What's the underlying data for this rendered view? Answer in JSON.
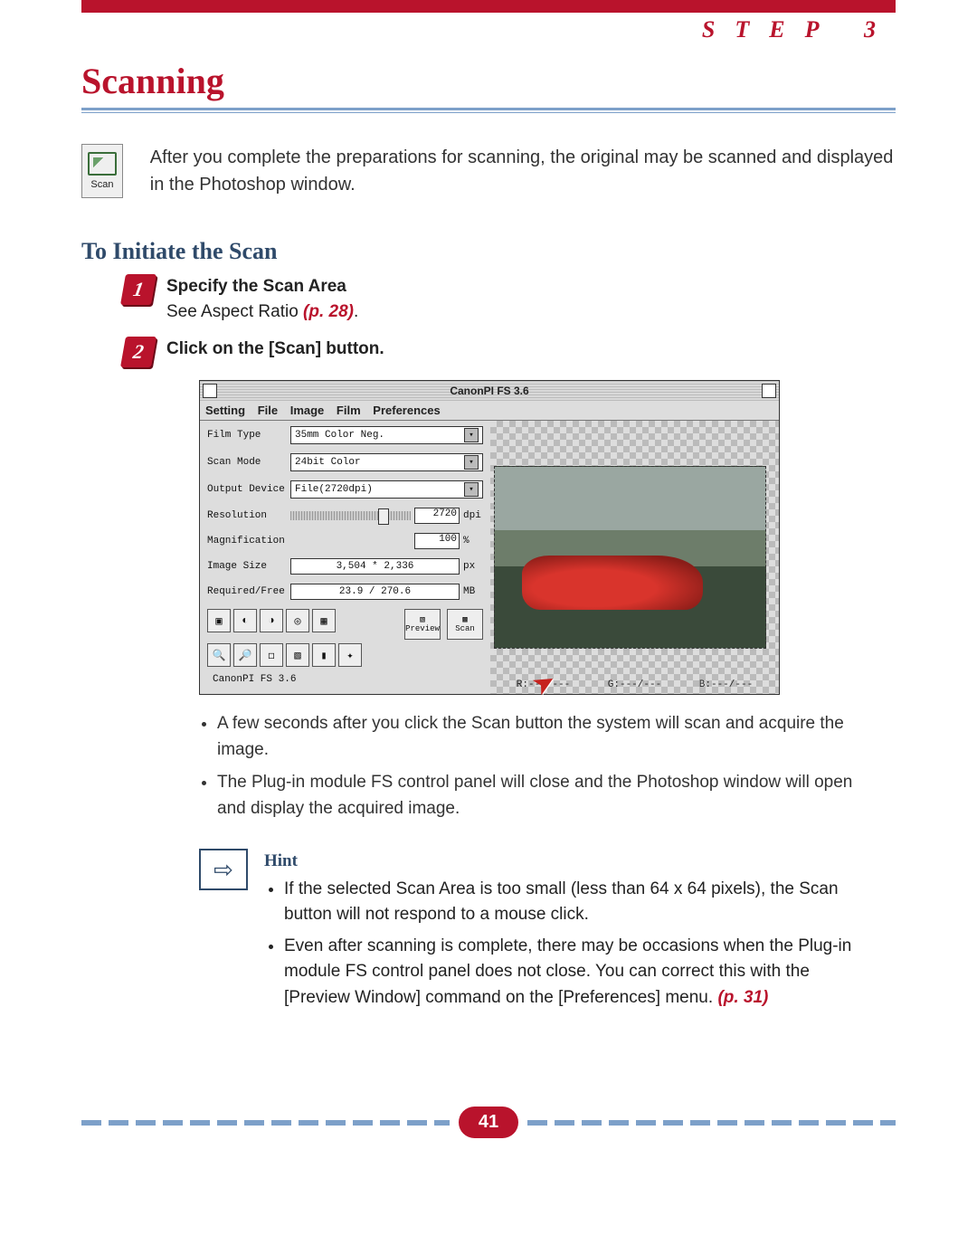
{
  "header": {
    "step_label": "STEP 3"
  },
  "title": "Scanning",
  "scan_chip": {
    "label": "Scan"
  },
  "intro": "After you complete the preparations for scanning, the original may be scanned and displayed in the Photoshop window.",
  "section": "To Initiate the Scan",
  "steps": [
    {
      "num": "1",
      "strong": "Specify the Scan Area",
      "line2_pre": "See Aspect Ratio ",
      "line2_ref": "(p. 28)",
      "line2_post": "."
    },
    {
      "num": "2",
      "strong": "Click on the [Scan] button."
    }
  ],
  "screenshot": {
    "window_title": "CanonPI FS 3.6",
    "menus": [
      "Setting",
      "File",
      "Image",
      "Film",
      "Preferences"
    ],
    "fields": {
      "film_type_label": "Film Type",
      "film_type_value": "35mm Color Neg.",
      "scan_mode_label": "Scan Mode",
      "scan_mode_value": "24bit Color",
      "output_device_label": "Output Device",
      "output_device_value": "File(2720dpi)",
      "resolution_label": "Resolution",
      "resolution_value": "2720",
      "resolution_unit": "dpi",
      "magnification_label": "Magnification",
      "magnification_value": "100",
      "magnification_unit": "%",
      "image_size_label": "Image Size",
      "image_size_value": "3,504 * 2,336",
      "image_size_unit": "px",
      "reqfree_label": "Required/Free",
      "reqfree_value": "23.9 / 270.6",
      "reqfree_unit": "MB"
    },
    "buttons": {
      "preview": "Preview",
      "scan": "Scan"
    },
    "status": "CanonPI FS 3.6",
    "rgb": {
      "r": "R:---/---",
      "g": "G:---/---",
      "b": "B:---/---"
    }
  },
  "bullets": [
    "A few seconds after you click the Scan button the system will scan and acquire the image.",
    "The Plug-in module FS control panel will close and the Photoshop window will open and display the acquired image."
  ],
  "hint": {
    "title": "Hint",
    "items": [
      {
        "text": "If the selected Scan Area is too small (less than 64 x 64 pixels), the Scan button will not respond to a mouse click."
      },
      {
        "text_pre": "Even after scanning is complete, there may be occasions when the Plug-in module FS control panel does not close.  You can correct this with the [Preview Window] command on the [Preferences] menu. ",
        "ref": "(p. 31)"
      }
    ]
  },
  "page_number": "41"
}
